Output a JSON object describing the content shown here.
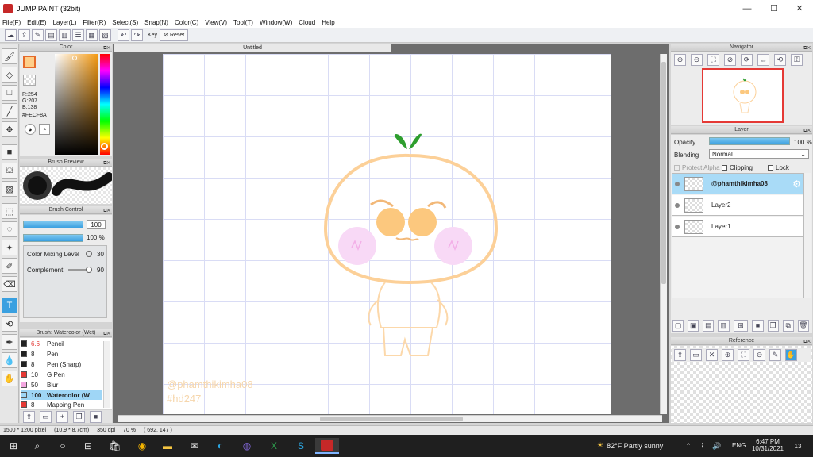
{
  "window": {
    "title": "JUMP PAINT (32bit)",
    "minimize": "—",
    "maximize": "☐",
    "close": "✕"
  },
  "menu": [
    "File(F)",
    "Edit(E)",
    "Layer(L)",
    "Filter(R)",
    "Select(S)",
    "Snap(N)",
    "Color(C)",
    "View(V)",
    "Tool(T)",
    "Window(W)",
    "Cloud",
    "Help"
  ],
  "toolbar": {
    "key_label": "Key",
    "reset_label": "Reset"
  },
  "color_panel": {
    "title": "Color",
    "r": "R:254",
    "g": "G:207",
    "b": "B:138",
    "hex": "#FECF8A",
    "main_color": "#FECF8A"
  },
  "brush_preview": {
    "title": "Brush Preview"
  },
  "brush_control": {
    "title": "Brush Control",
    "size": "100",
    "opacity": "100 %",
    "mixing_label": "Color Mixing Level",
    "mixing_value": "30",
    "complement_label": "Complement",
    "complement_value": "90"
  },
  "brush_list": {
    "title": "Brush: Watercolor (Wet)",
    "items": [
      {
        "size": "6.6",
        "name": "Pencil",
        "color": "#222222"
      },
      {
        "size": "8",
        "name": "Pen",
        "color": "#222222"
      },
      {
        "size": "8",
        "name": "Pen (Sharp)",
        "color": "#222222"
      },
      {
        "size": "10",
        "name": "G Pen",
        "color": "#e53935"
      },
      {
        "size": "50",
        "name": "Blur",
        "color": "#f3a7e0"
      },
      {
        "size": "100",
        "name": "Watercolor (W",
        "color": "#9fd6f6"
      },
      {
        "size": "8",
        "name": "Mapping Pen",
        "color": "#e53935"
      }
    ]
  },
  "canvas": {
    "tab_title": "Untitled",
    "watermark_1": "@phamthikimha08",
    "watermark_2": "#hd247"
  },
  "navigator": {
    "title": "Navigator"
  },
  "layer_panel": {
    "title": "Layer",
    "opacity_label": "Opacity",
    "opacity_value": "100 %",
    "blending_label": "Blending",
    "blending_value": "Normal",
    "protect_alpha": "Protect Alpha",
    "clipping": "Clipping",
    "lock": "Lock",
    "layers": [
      "@phamthikimha08",
      "Layer2",
      "Layer1"
    ]
  },
  "reference": {
    "title": "Reference"
  },
  "status": {
    "size": "1500 * 1200 pixel",
    "physical": "(10.9 * 8.7cm)",
    "dpi": "350 dpi",
    "zoom": "70 %",
    "coords": "( 692, 147 )"
  },
  "taskbar": {
    "weather": "82°F  Partly sunny",
    "lang": "ENG",
    "time": "6:47 PM",
    "date": "10/31/2021",
    "notif": "13"
  }
}
